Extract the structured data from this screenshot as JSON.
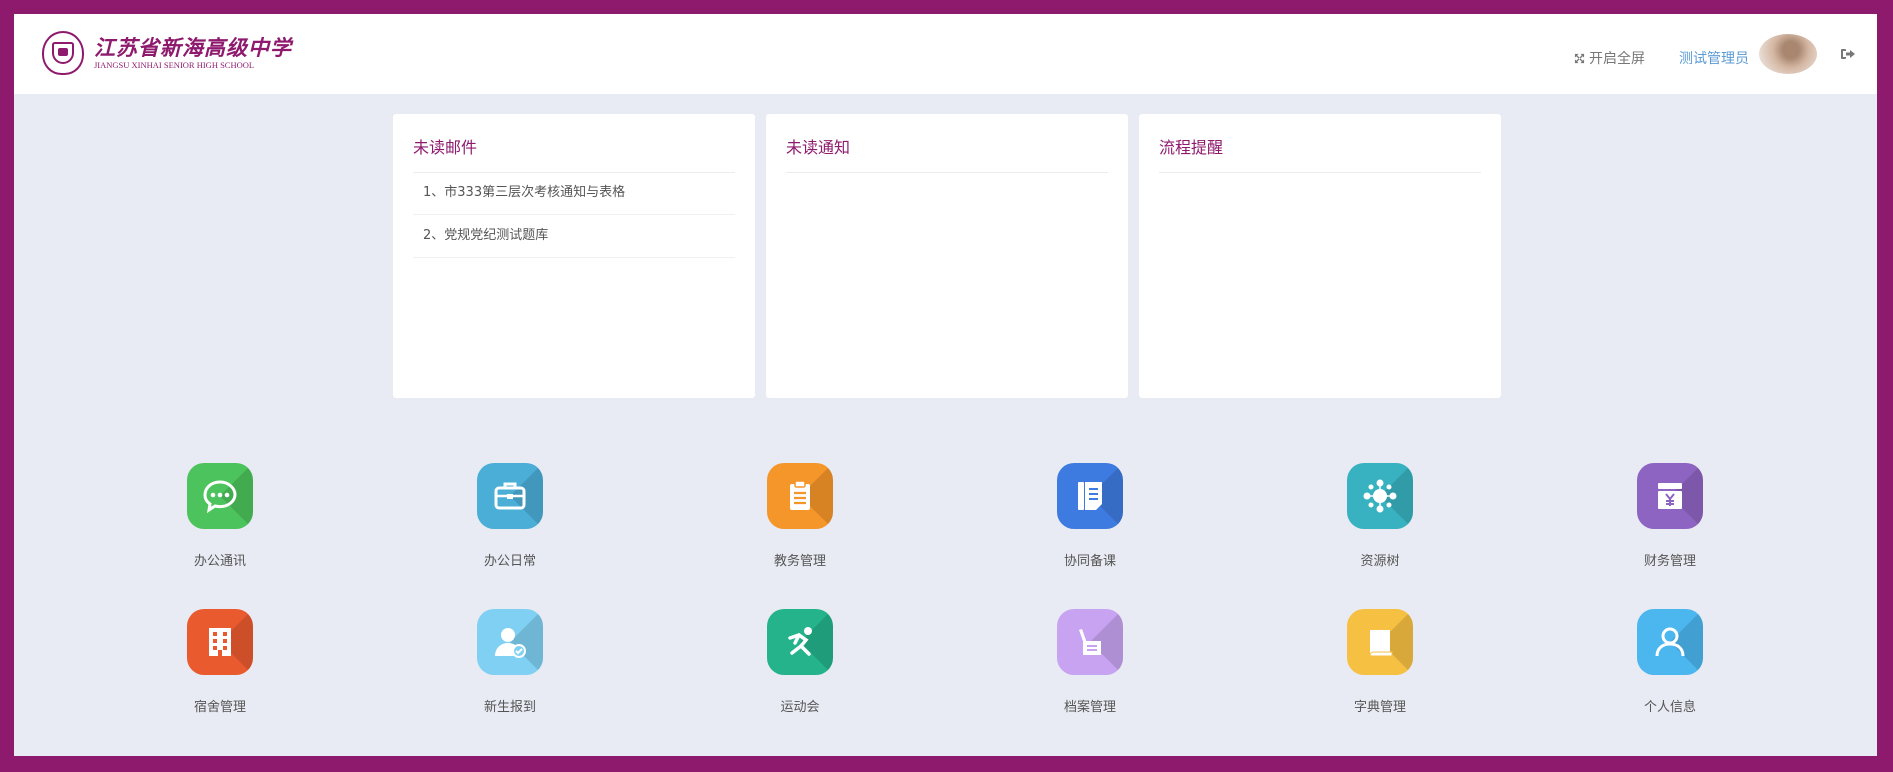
{
  "header": {
    "logo_cn": "江苏省新海高级中学",
    "logo_en": "JIANGSU XINHAI SENIOR HIGH SCHOOL",
    "fullscreen_label": "开启全屏",
    "username": "测试管理员"
  },
  "cards": {
    "mail": {
      "title": "未读邮件",
      "items": [
        "1、市333第三层次考核通知与表格",
        "2、党规党纪测试题库"
      ]
    },
    "notice": {
      "title": "未读通知"
    },
    "process": {
      "title": "流程提醒"
    }
  },
  "apps": [
    {
      "label": "办公通讯",
      "icon": "chat-bubble-icon",
      "color": "#4cc35c"
    },
    {
      "label": "办公日常",
      "icon": "briefcase-icon",
      "color": "#4aaed6"
    },
    {
      "label": "教务管理",
      "icon": "clipboard-icon",
      "color": "#f5962a"
    },
    {
      "label": "协同备课",
      "icon": "document-icon",
      "color": "#3e7be0"
    },
    {
      "label": "资源树",
      "icon": "network-icon",
      "color": "#38b2c0"
    },
    {
      "label": "财务管理",
      "icon": "finance-icon",
      "color": "#8e64c2"
    },
    {
      "label": "宿舍管理",
      "icon": "building-icon",
      "color": "#ea5a2f"
    },
    {
      "label": "新生报到",
      "icon": "user-check-icon",
      "color": "#7fd0f2"
    },
    {
      "label": "运动会",
      "icon": "runner-icon",
      "color": "#24b38b"
    },
    {
      "label": "档案管理",
      "icon": "archive-icon",
      "color": "#c7a3f2"
    },
    {
      "label": "字典管理",
      "icon": "book-icon",
      "color": "#f6c142"
    },
    {
      "label": "个人信息",
      "icon": "person-icon",
      "color": "#4cb6ee"
    }
  ]
}
